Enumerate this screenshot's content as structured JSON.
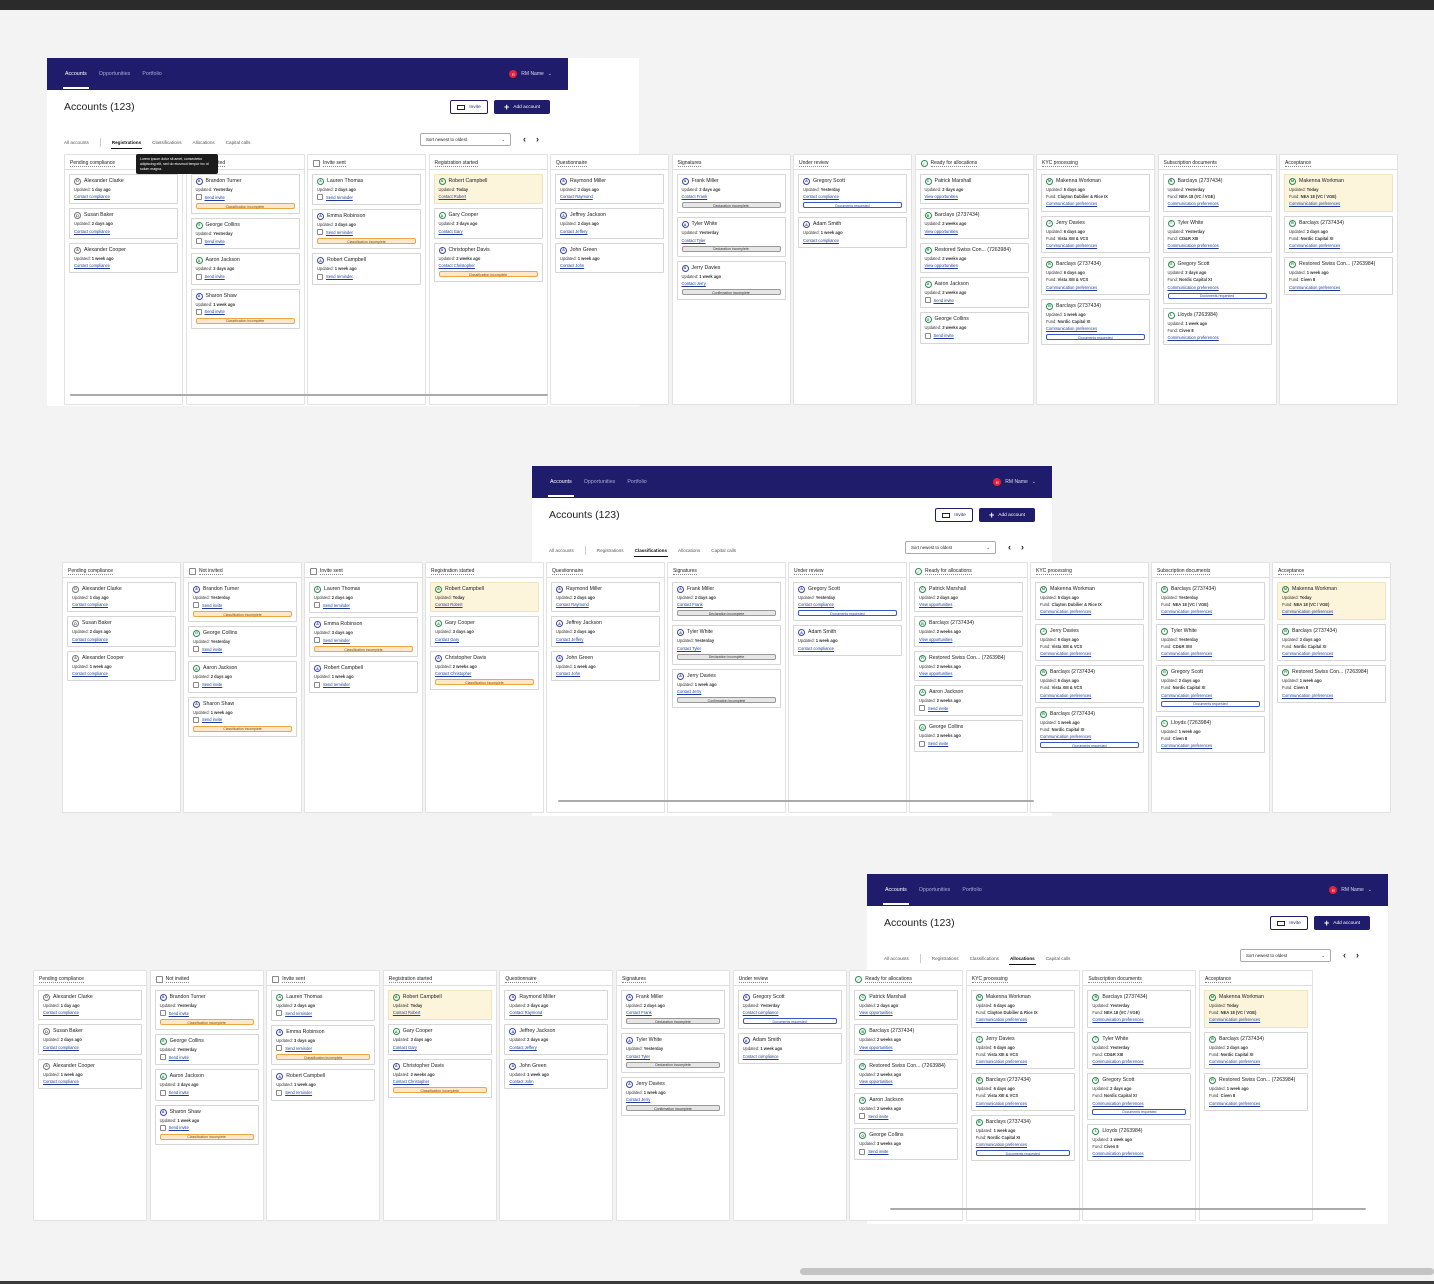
{
  "nav": {
    "tabs": [
      "Accounts",
      "Opportunities",
      "Portfolio"
    ],
    "user": "RM Name",
    "user_initial": "R"
  },
  "header": {
    "title": "Accounts (123)",
    "invite": "Invite",
    "add": "Add account"
  },
  "filters": [
    "All accounts",
    "Registrations",
    "Classifications",
    "Allocations",
    "Capital calls"
  ],
  "sort": "Sort newest to oldest",
  "tooltip": "Lorem ipsum dolor sit amet, consectetur adipiscing elit, sed do eiusmod tempor inc id solum magna.",
  "columns": [
    {
      "title": "Pending compliance",
      "type": "plain",
      "cards": [
        {
          "icon": "D",
          "icolor": "gray",
          "name": "Alexander Clarke",
          "updated": "1 day ago",
          "link": "Contact compliance"
        },
        {
          "icon": "D",
          "icolor": "gray",
          "name": "Susan Baker",
          "updated": "2 days ago",
          "link": "Contact compliance"
        },
        {
          "icon": "A",
          "icolor": "gray",
          "name": "Alexander Cooper",
          "updated": "1 week ago",
          "link": "Contact compliance"
        }
      ]
    },
    {
      "title": "Not invited",
      "type": "check",
      "cards": [
        {
          "icon": "A",
          "icolor": "blue",
          "name": "Brandon Turner",
          "updated": "Yesterday",
          "invite": "Send invite",
          "tag": "Classification incomplete",
          "tagc": "orange"
        },
        {
          "icon": "G",
          "icolor": "green",
          "name": "George Collins",
          "updated": "Yesterday",
          "invite": "Send invite"
        },
        {
          "icon": "A",
          "icolor": "green",
          "name": "Aaron Jackson",
          "updated": "2 days ago",
          "invite": "Send invite"
        },
        {
          "icon": "A",
          "icolor": "blue",
          "name": "Sharon Shaw",
          "updated": "1 week ago",
          "invite": "Send invite",
          "tag": "Classification incomplete",
          "tagc": "orange"
        }
      ]
    },
    {
      "title": "Invite sent",
      "type": "check",
      "cards": [
        {
          "icon": "A",
          "icolor": "green",
          "name": "Lauren Thomas",
          "updated": "2 days ago",
          "invite": "Send reminder"
        },
        {
          "icon": "A",
          "icolor": "blue",
          "name": "Emma Robinson",
          "updated": "3 days ago",
          "invite": "Send reminder",
          "tag": "Classification incomplete",
          "tagc": "orange"
        },
        {
          "icon": "A",
          "icolor": "blue",
          "name": "Robert Campbell",
          "updated": "1 week ago",
          "invite": "Send reminder"
        }
      ]
    },
    {
      "title": "Registration started",
      "type": "plain",
      "cards": [
        {
          "icon": "A",
          "icolor": "green",
          "name": "Robert Campbell",
          "updated": "Today",
          "link": "Contact Robert",
          "hl": true
        },
        {
          "icon": "A",
          "icolor": "green",
          "name": "Gary Cooper",
          "updated": "3 days ago",
          "link": "Contact Gary"
        },
        {
          "icon": "A",
          "icolor": "blue",
          "name": "Christopher Davis",
          "updated": "2 weeks ago",
          "link": "Contact Christopher",
          "tag": "Classification incomplete",
          "tagc": "orange"
        }
      ]
    },
    {
      "title": "Questionnaire",
      "type": "plain",
      "cards": [
        {
          "icon": "A",
          "icolor": "blue",
          "name": "Raymond Miller",
          "updated": "2 days ago",
          "link": "Contact Raymond"
        },
        {
          "icon": "A",
          "icolor": "blue",
          "name": "Jeffrey Jackson",
          "updated": "2 days ago",
          "link": "Contact Jeffery"
        },
        {
          "icon": "A",
          "icolor": "blue",
          "name": "John Green",
          "updated": "1 week ago",
          "link": "Contact John"
        }
      ]
    },
    {
      "title": "Signatures",
      "type": "plain",
      "cards": [
        {
          "icon": "A",
          "icolor": "blue",
          "name": "Frank Miller",
          "updated": "2 days ago",
          "link": "Contact Frank",
          "tag": "Declaration incomplete",
          "tagc": "gray"
        },
        {
          "icon": "A",
          "icolor": "blue",
          "name": "Tyler White",
          "updated": "Yesterday",
          "link": "Contact Tyler",
          "tag": "Declaration incomplete",
          "tagc": "gray"
        },
        {
          "icon": "A",
          "icolor": "blue",
          "name": "Jerry Davies",
          "updated": "1 week ago",
          "link": "Contact Jerry",
          "tag": "Confirmation incomplete",
          "tagc": "gray"
        }
      ]
    },
    {
      "title": "Under review",
      "type": "plain",
      "cards": [
        {
          "icon": "A",
          "icolor": "blue",
          "name": "Gregory Scott",
          "updated": "Yesterday",
          "link": "Contact compliance",
          "tag": "Documents requested",
          "tagc": "blue"
        },
        {
          "icon": "A",
          "icolor": "blue",
          "name": "Adam Smith",
          "updated": "1 week ago",
          "link": "Contact compliance"
        }
      ]
    },
    {
      "title": "Ready for allocations",
      "type": "ok",
      "cards": [
        {
          "icon": "C",
          "icolor": "green",
          "name": "Patrick Marshall",
          "updated": "2 days ago",
          "link": "View opportunities"
        },
        {
          "icon": "B",
          "icolor": "green",
          "name": "Barclays (2737434)",
          "updated": "2 weeks ago",
          "link": "View opportunities"
        },
        {
          "icon": "R",
          "icolor": "green",
          "name": "Restored Swiss Con... (7263984)",
          "updated": "2 weeks ago",
          "link": "View opportunities"
        },
        {
          "icon": "A",
          "icolor": "green",
          "name": "Aaron Jackson",
          "updated": "2 weeks ago",
          "invite": "Send invite"
        },
        {
          "icon": "G",
          "icolor": "green",
          "name": "George Collins",
          "updated": "3 weeks ago",
          "invite": "Send invite"
        }
      ]
    },
    {
      "title": "KYC processing",
      "type": "plain",
      "cards": [
        {
          "icon": "M",
          "icolor": "green",
          "name": "Makenna Workman",
          "updated": "5 days ago",
          "fund": "Clayton Dubilier & Rice IX",
          "link": "Communication preferences"
        },
        {
          "icon": "J",
          "icolor": "green",
          "name": "Jerry Davies",
          "updated": "6 days ago",
          "fund": "Vista XIII & VCS",
          "link": "Communication preferences"
        },
        {
          "icon": "B",
          "icolor": "green",
          "name": "Barclays (2737434)",
          "updated": "6 days ago",
          "fund": "Vista XIII & VCS",
          "link": "Communication preferences"
        },
        {
          "icon": "B",
          "icolor": "green",
          "name": "Barclays (2737434)",
          "updated": "1 week ago",
          "fund": "Nordic Capital XI",
          "link": "Communication preferences",
          "tag": "Documents requested",
          "tagc": "blue"
        }
      ]
    },
    {
      "title": "Subscription documents",
      "type": "plain",
      "cards": [
        {
          "icon": "B",
          "icolor": "green",
          "name": "Barclays (2737434)",
          "updated": "Yesterday",
          "fund": "NEA 18 (VC / VGE)",
          "link": "Communication preferences"
        },
        {
          "icon": "T",
          "icolor": "green",
          "name": "Tyler White",
          "updated": "Yesterday",
          "fund": "CD&R XIII",
          "link": "Communication preferences"
        },
        {
          "icon": "G",
          "icolor": "green",
          "name": "Gregory Scott",
          "updated": "2 days ago",
          "fund": "Nordic Capital XI",
          "link": "Communication preferences",
          "tag": "Documents requested",
          "tagc": "blue"
        },
        {
          "icon": "L",
          "icolor": "green",
          "name": "Lloyds (7263984)",
          "updated": "1 week ago",
          "fund": "Civen 8",
          "link": "Communication preferences"
        }
      ]
    },
    {
      "title": "Acceptance",
      "type": "plain",
      "cards": [
        {
          "icon": "M",
          "icolor": "green",
          "name": "Makenna Workman",
          "updated": "Today",
          "fund": "NEA 18 (VC / VGE)",
          "link": "Communication preferences",
          "hl": true
        },
        {
          "icon": "B",
          "icolor": "green",
          "name": "Barclays (2737434)",
          "updated": "2 days ago",
          "fund": "Nordic Capital XI",
          "link": "Communication preferences"
        },
        {
          "icon": "R",
          "icolor": "green",
          "name": "Restored Swiss Con... (7263984)",
          "updated": "1 week ago",
          "fund": "Civen 8",
          "link": "Communication preferences"
        }
      ]
    }
  ],
  "labels": {
    "updated": "Updated:",
    "fund": "Fund:"
  }
}
